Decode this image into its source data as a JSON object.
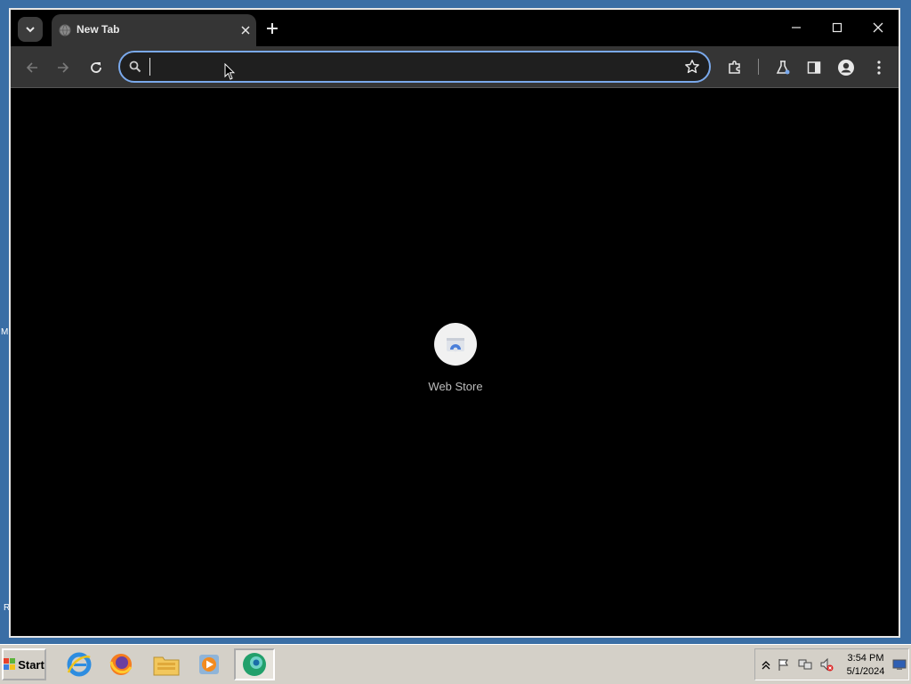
{
  "desktop": {
    "left_fragment_1": "M",
    "left_fragment_2": "R"
  },
  "browser": {
    "tab": {
      "title": "New Tab"
    },
    "omnibox": {
      "value": "",
      "placeholder": ""
    },
    "shortcuts": [
      {
        "label": "Web Store"
      }
    ]
  },
  "taskbar": {
    "start_label": "Start",
    "apps": [
      "internet-explorer",
      "firefox",
      "file-explorer",
      "media-player",
      "chrome"
    ],
    "clock": {
      "time": "3:54 PM",
      "date": "5/1/2024"
    }
  },
  "colors": {
    "accent": "#7aa9ec",
    "toolbar": "#353535",
    "content_bg": "#000000",
    "desktop": "#3a6ea5"
  }
}
